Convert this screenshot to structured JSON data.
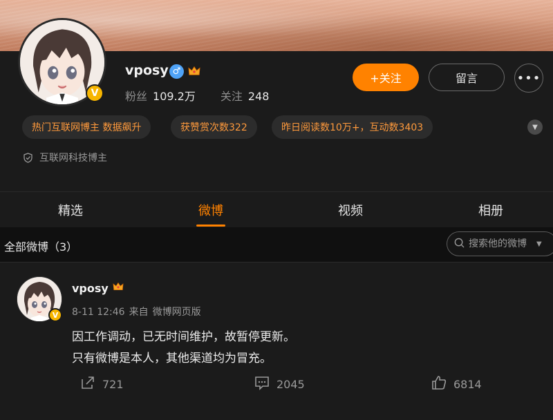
{
  "profile": {
    "name": "vposy",
    "gender_symbol": "♂",
    "fans_label": "粉丝",
    "fans_count": "109.2万",
    "following_label": "关注",
    "following_count": "248",
    "follow_button": "+关注",
    "message_button": "留言",
    "more_button": "•••",
    "verified_badge": "V",
    "tags": [
      "热门互联网博主 数据飙升",
      "获赞赏次数322",
      "昨日阅读数10万+，互动数3403"
    ],
    "verification": "互联网科技博主"
  },
  "tabs": [
    "精选",
    "微博",
    "视频",
    "相册"
  ],
  "active_tab": "微博",
  "filter": {
    "label": "全部微博（3）",
    "search_placeholder": "搜索他的微博"
  },
  "post": {
    "author": "vposy",
    "time": "8-11 12:46",
    "source_prefix": "来自",
    "source": "微博网页版",
    "lines": [
      "因工作调动，已无时间维护，故暂停更新。",
      "只有微博是本人，其他渠道均为冒充。"
    ],
    "reposts": "721",
    "comments": "2045",
    "likes": "6814"
  },
  "colors": {
    "accent": "#ff8200",
    "background": "#101010",
    "card": "#1b1b1b",
    "tag_text": "#ff9a3c",
    "verified": "#f7b500",
    "gender": "#4fa3f7"
  },
  "icons": [
    "verified-icon",
    "male-icon",
    "crown-icon",
    "more-icon",
    "chevron-down-icon",
    "shield-icon",
    "search-icon",
    "repost-icon",
    "comment-icon",
    "like-icon"
  ]
}
